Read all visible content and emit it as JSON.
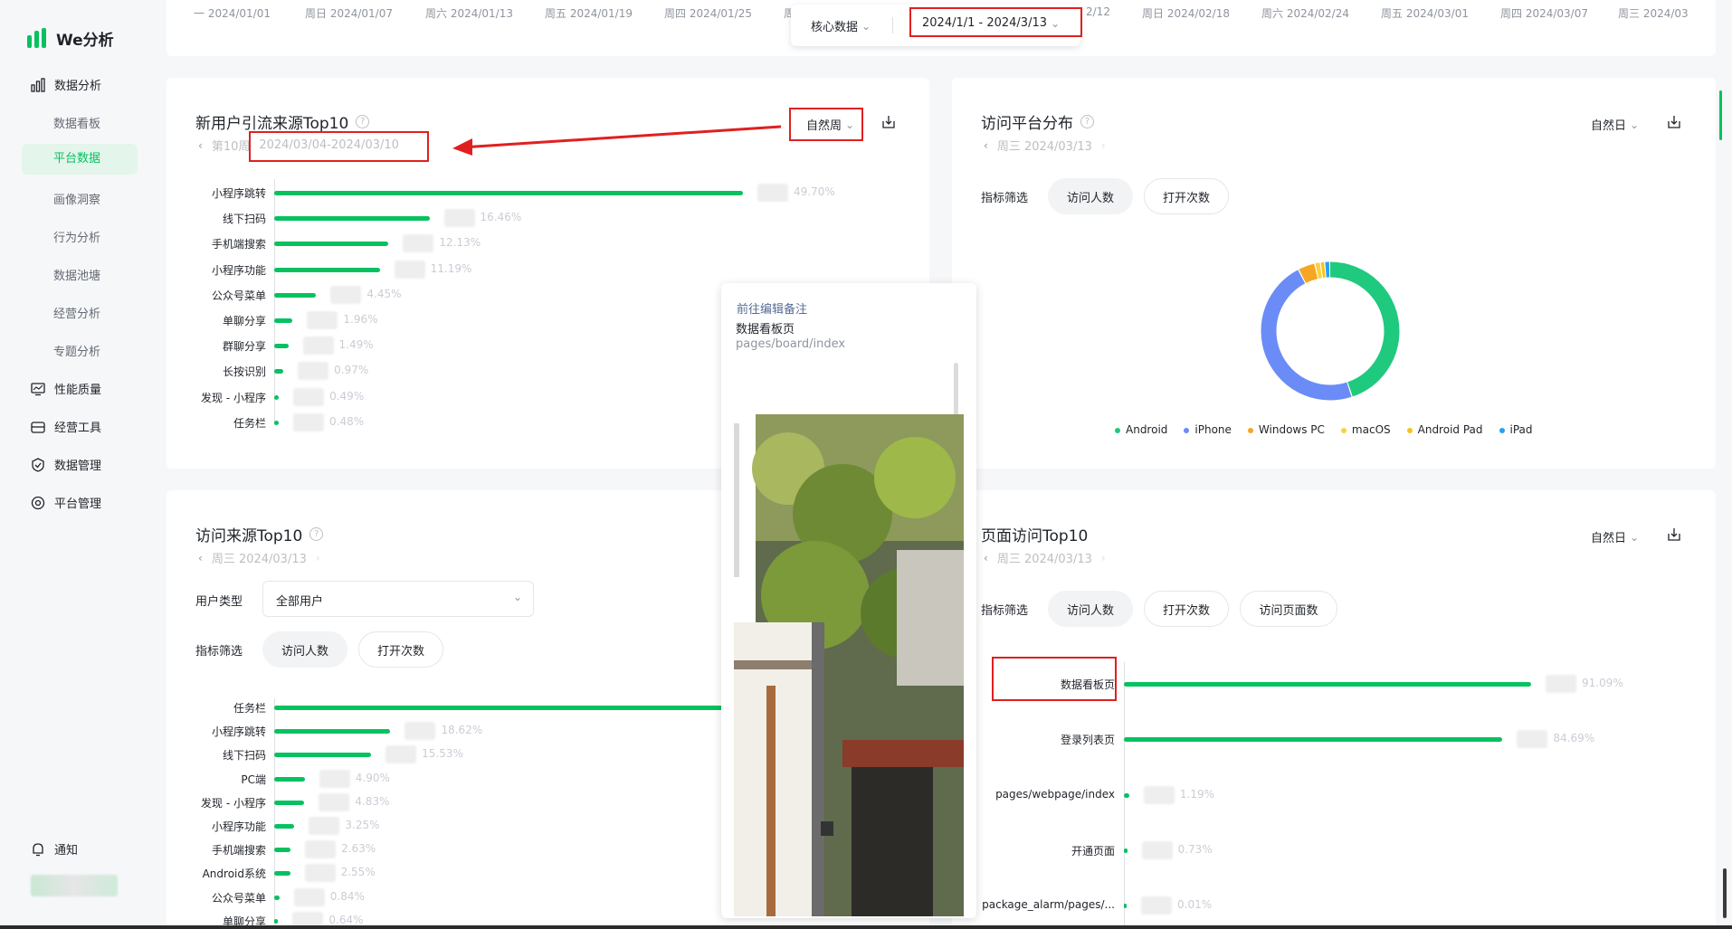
{
  "app": {
    "name": "We分析"
  },
  "sidebar": {
    "sections": [
      {
        "label": "数据分析",
        "icon": "bar-chart-icon"
      },
      {
        "label": "性能质量",
        "icon": "monitor-icon"
      },
      {
        "label": "经营工具",
        "icon": "wallet-icon"
      },
      {
        "label": "数据管理",
        "icon": "shield-icon"
      },
      {
        "label": "平台管理",
        "icon": "settings-icon"
      }
    ],
    "subitems": [
      "数据看板",
      "平台数据",
      "画像洞察",
      "行为分析",
      "数据池塘",
      "经营分析",
      "专题分析"
    ],
    "active": "平台数据",
    "notice": "通知"
  },
  "top_strip": {
    "dates": [
      "一 2024/01/01",
      "周日 2024/01/07",
      "周六 2024/01/13",
      "周五 2024/01/19",
      "周四 2024/01/25",
      "周",
      "2/12",
      "周日 2024/02/18",
      "周六 2024/02/24",
      "周五 2024/03/01",
      "周四 2024/03/07",
      "周三 2024/03"
    ],
    "filter_label": "核心数据",
    "date_range": "2024/1/1  - 2024/3/13"
  },
  "card_new_users": {
    "title": "新用户引流来源Top10",
    "week": "第10周",
    "range": "2024/03/04-2024/03/10",
    "period": "自然周",
    "rows": [
      {
        "label": "小程序跳转",
        "pct": "49.70%",
        "value": 49.7
      },
      {
        "label": "线下扫码",
        "pct": "16.46%",
        "value": 16.46
      },
      {
        "label": "手机端搜索",
        "pct": "12.13%",
        "value": 12.13
      },
      {
        "label": "小程序功能",
        "pct": "11.19%",
        "value": 11.19
      },
      {
        "label": "公众号菜单",
        "pct": "4.45%",
        "value": 4.45
      },
      {
        "label": "单聊分享",
        "pct": "1.96%",
        "value": 1.96
      },
      {
        "label": "群聊分享",
        "pct": "1.49%",
        "value": 1.49
      },
      {
        "label": "长按识别",
        "pct": "0.97%",
        "value": 0.97
      },
      {
        "label": "发现 - 小程序",
        "pct": "0.49%",
        "value": 0.49
      },
      {
        "label": "任务栏",
        "pct": "0.48%",
        "value": 0.48
      }
    ]
  },
  "card_platform": {
    "title": "访问平台分布",
    "date": "周三 2024/03/13",
    "period": "自然日",
    "filter_label": "指标筛选",
    "pills": [
      "访问人数",
      "打开次数"
    ],
    "donut": [
      {
        "name": "Android",
        "value": 45.0,
        "color": "#1fc97e"
      },
      {
        "name": "iPhone",
        "value": 47.5,
        "color": "#6b8cf6"
      },
      {
        "name": "Windows PC",
        "value": 4.0,
        "color": "#f5a623"
      },
      {
        "name": "macOS",
        "value": 1.3,
        "color": "#f7d23b"
      },
      {
        "name": "Android Pad",
        "value": 1.0,
        "color": "#f7c21b"
      },
      {
        "name": "iPad",
        "value": 1.2,
        "color": "#2b9ff5"
      }
    ]
  },
  "card_sources": {
    "title": "访问来源Top10",
    "date": "周三 2024/03/13",
    "user_type_label": "用户类型",
    "user_type_value": "全部用户",
    "filter_label": "指标筛选",
    "pills": [
      "访问人数",
      "打开次数"
    ],
    "rows": [
      {
        "label": "任务栏",
        "pct": "",
        "value": 100
      },
      {
        "label": "小程序跳转",
        "pct": "18.62%",
        "value": 18.62
      },
      {
        "label": "线下扫码",
        "pct": "15.53%",
        "value": 15.53
      },
      {
        "label": "PC端",
        "pct": "4.90%",
        "value": 4.9
      },
      {
        "label": "发现 - 小程序",
        "pct": "4.83%",
        "value": 4.83
      },
      {
        "label": "小程序功能",
        "pct": "3.25%",
        "value": 3.25
      },
      {
        "label": "手机端搜索",
        "pct": "2.63%",
        "value": 2.63
      },
      {
        "label": "Android系统",
        "pct": "2.55%",
        "value": 2.55
      },
      {
        "label": "公众号菜单",
        "pct": "0.84%",
        "value": 0.84
      },
      {
        "label": "单聊分享",
        "pct": "0.64%",
        "value": 0.64
      }
    ]
  },
  "card_pages": {
    "title": "页面访问Top10",
    "date": "周三 2024/03/13",
    "period": "自然日",
    "filter_label": "指标筛选",
    "pills": [
      "访问人数",
      "打开次数",
      "访问页面数"
    ],
    "rows": [
      {
        "label": "数据看板页",
        "pct": "91.09%",
        "value": 91.09
      },
      {
        "label": "登录列表页",
        "pct": "84.69%",
        "value": 84.69
      },
      {
        "label": "pages/webpage/index",
        "pct": "1.19%",
        "value": 1.19
      },
      {
        "label": "开通页面",
        "pct": "0.73%",
        "value": 0.73
      },
      {
        "label": "package_alarm/pages/...",
        "pct": "0.01%",
        "value": 0.01
      }
    ]
  },
  "popup": {
    "link": "前往编辑备注",
    "page_name": "数据看板页",
    "page_path": "pages/board/index"
  },
  "colors": {
    "accent": "#07c160",
    "annotation": "#e02020"
  }
}
